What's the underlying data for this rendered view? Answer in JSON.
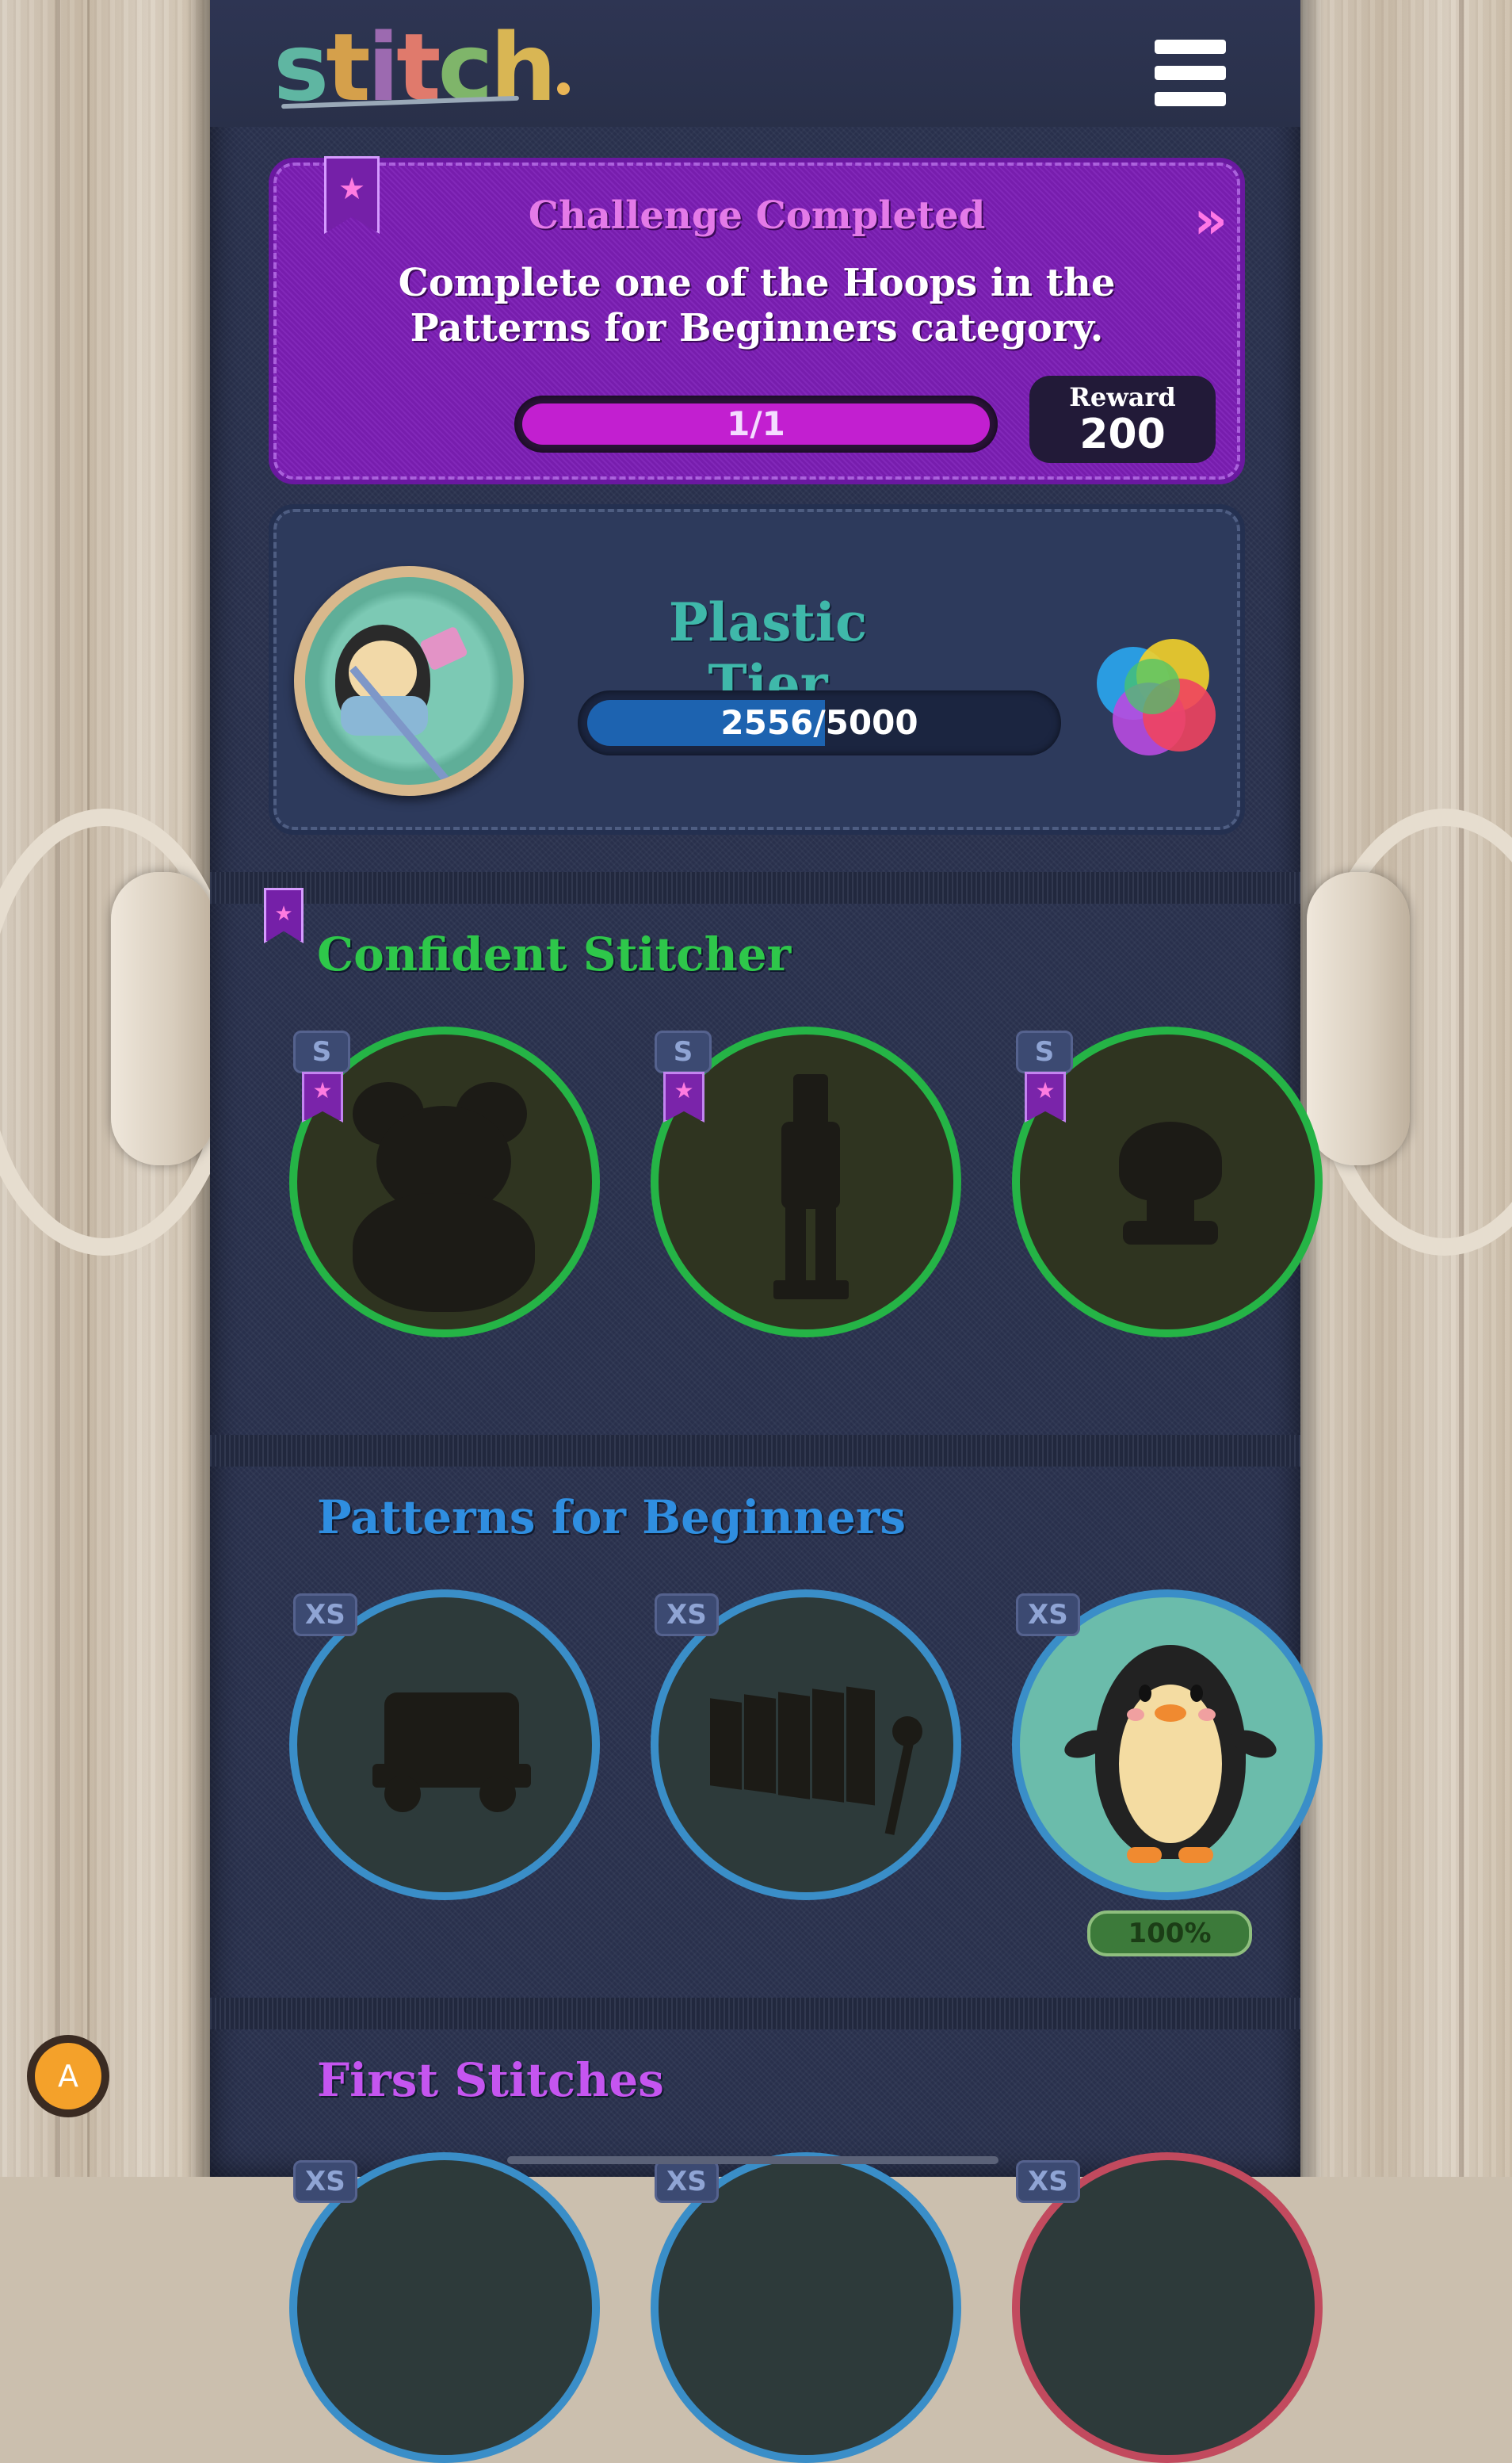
{
  "app": {
    "logo_text": "stitch"
  },
  "menu": {
    "icon": "hamburger-menu-icon"
  },
  "challenge": {
    "title": "Challenge Completed",
    "description": "Complete one of the Hoops in the Patterns for Beginners category.",
    "progress_label": "1/1",
    "progress": 1.0,
    "reward_label": "Reward",
    "reward_value": "200",
    "next_icon": "double-chevron-right-icon"
  },
  "tier": {
    "title": "Plastic Tier",
    "progress_label": "2556/5000",
    "progress": 0.5112,
    "avatar_icon": "penguin-stitching-avatar",
    "badge_icon": "plastic-tier-orb-icon"
  },
  "sections": [
    {
      "title": "Confident Stitcher",
      "color": "#2ec74a",
      "ring_color": "#25b446",
      "hoops": [
        {
          "size": "S",
          "name": "teddy-bear",
          "completed": false
        },
        {
          "size": "S",
          "name": "nutcracker",
          "completed": false
        },
        {
          "size": "S",
          "name": "mushroom",
          "completed": false
        }
      ]
    },
    {
      "title": "Patterns for Beginners",
      "color": "#2f8ee0",
      "ring_color": "#3a8ec8",
      "hoops": [
        {
          "size": "XS",
          "name": "train",
          "completed": false
        },
        {
          "size": "XS",
          "name": "xylophone",
          "completed": false
        },
        {
          "size": "XS",
          "name": "penguin",
          "completed": true,
          "percent": "100%"
        }
      ]
    },
    {
      "title": "First Stitches",
      "color": "#c555f0",
      "ring_color": "#3a8ec8",
      "hoops": [
        {
          "size": "XS"
        },
        {
          "size": "XS"
        },
        {
          "size": "XS"
        }
      ]
    }
  ],
  "user": {
    "avatar_initial": "A"
  }
}
